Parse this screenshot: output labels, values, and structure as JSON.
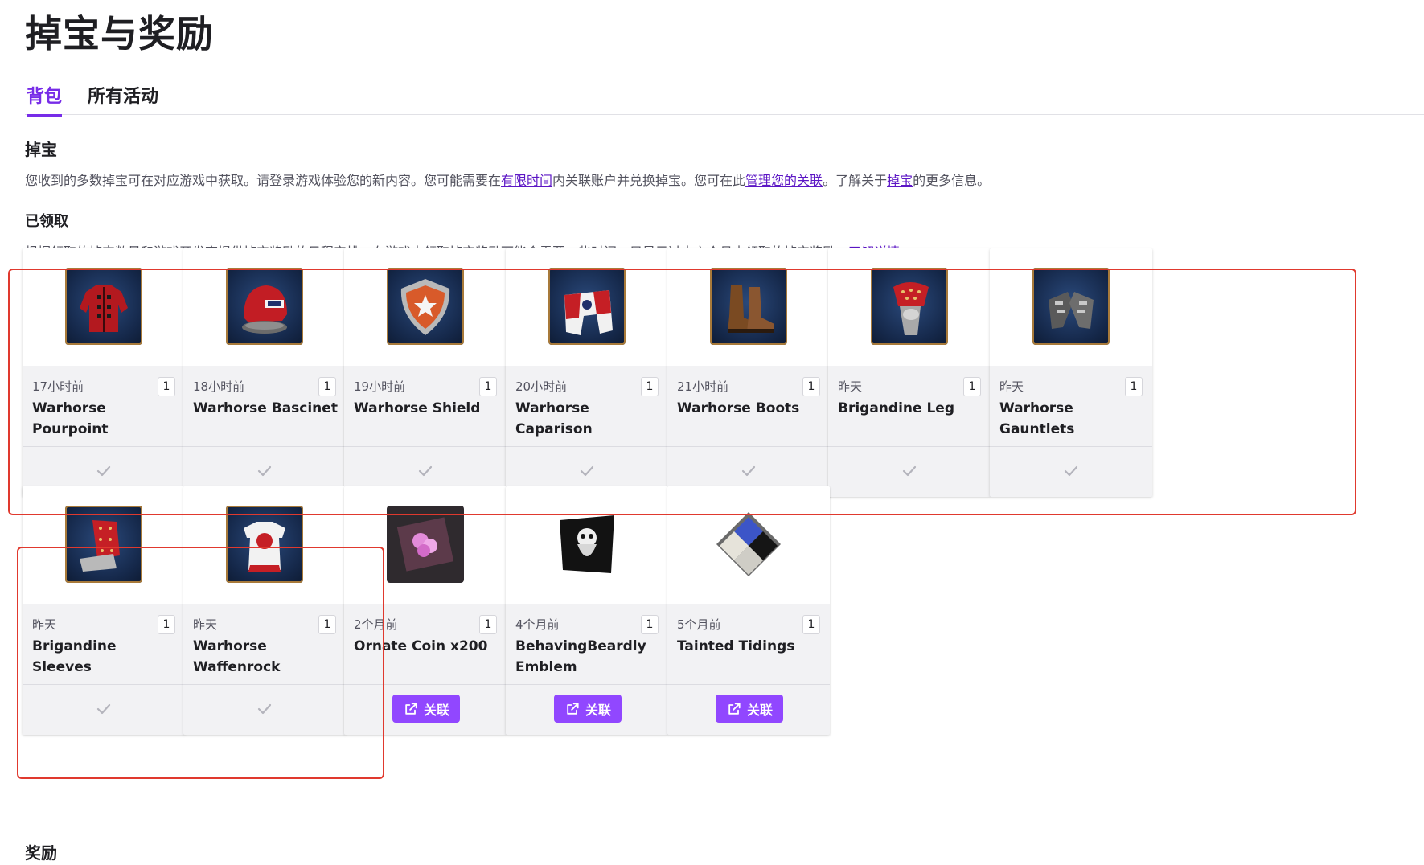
{
  "page": {
    "title": "掉宝与奖励"
  },
  "tabs": [
    {
      "label": "背包",
      "active": true
    },
    {
      "label": "所有活动",
      "active": false
    }
  ],
  "drops": {
    "title": "掉宝",
    "desc": {
      "p1": "您收到的多数掉宝可在对应游戏中获取。请登录游戏体验您的新内容。您可能需要在",
      "link1": "有限时间",
      "p2": "内关联账户并兑换掉宝。您可在此",
      "link2": "管理您的关联",
      "p3": "。了解关于",
      "link3": "掉宝",
      "p4": "的更多信息。"
    }
  },
  "claimed": {
    "title": "已领取",
    "desc": {
      "p1": "根据领取的掉宝数量和游戏开发商提供掉宝奖励的日程安排，在游戏中领取掉宝奖励可能会需要一些时间。只显示过去六个月内领取的掉宝奖励。",
      "link": "了解详情",
      "p2": "。"
    }
  },
  "cards": [
    {
      "time": "17小时前",
      "qty": "1",
      "name": "Warhorse Pourpoint",
      "icon": "pourpoint-icon",
      "status": "claimed"
    },
    {
      "time": "18小时前",
      "qty": "1",
      "name": "Warhorse Bascinet",
      "icon": "bascinet-icon",
      "status": "claimed"
    },
    {
      "time": "19小时前",
      "qty": "1",
      "name": "Warhorse Shield",
      "icon": "shield-icon",
      "status": "claimed"
    },
    {
      "time": "20小时前",
      "qty": "1",
      "name": "Warhorse Caparison",
      "icon": "caparison-icon",
      "status": "claimed"
    },
    {
      "time": "21小时前",
      "qty": "1",
      "name": "Warhorse Boots",
      "icon": "boots-icon",
      "status": "claimed"
    },
    {
      "time": "昨天",
      "qty": "1",
      "name": "Brigandine Leg",
      "icon": "brigandine-leg-icon",
      "status": "claimed"
    },
    {
      "time": "昨天",
      "qty": "1",
      "name": "Warhorse Gauntlets",
      "icon": "gauntlets-icon",
      "status": "claimed"
    },
    {
      "time": "昨天",
      "qty": "1",
      "name": "Brigandine Sleeves",
      "icon": "brigandine-sleeves-icon",
      "status": "claimed"
    },
    {
      "time": "昨天",
      "qty": "1",
      "name": "Warhorse Waffenrock",
      "icon": "waffenrock-icon",
      "status": "claimed"
    },
    {
      "time": "2个月前",
      "qty": "1",
      "name": "Ornate Coin x200",
      "icon": "ornate-coin-icon",
      "status": "connect"
    },
    {
      "time": "4个月前",
      "qty": "1",
      "name": "BehavingBeardly Emblem",
      "icon": "pirate-flag-icon",
      "status": "connect"
    },
    {
      "time": "5个月前",
      "qty": "1",
      "name": "Tainted Tidings",
      "icon": "diamond-emblem-icon",
      "status": "connect"
    }
  ],
  "connect_label": "关联",
  "rewards": {
    "title": "奖励"
  },
  "colors": {
    "accent": "#9147ff",
    "link": "#5c16c5",
    "highlight": "#e0392e"
  }
}
